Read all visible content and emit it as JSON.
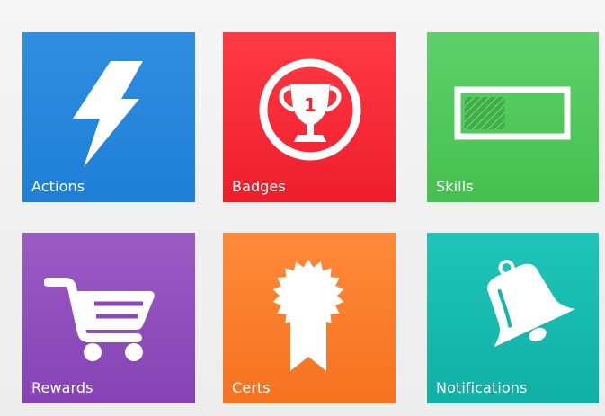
{
  "tiles": {
    "actions": {
      "label": "Actions",
      "icon": "lightning-bolt-icon",
      "color": "#2385d9"
    },
    "badges": {
      "label": "Badges",
      "icon": "trophy-icon",
      "trophy_number": "1",
      "color": "#f52936"
    },
    "skills": {
      "label": "Skills",
      "icon": "progress-bar-icon",
      "progress": 0.42,
      "color": "#52c85c"
    },
    "rewards": {
      "label": "Rewards",
      "icon": "shopping-cart-icon",
      "color": "#8f4dbc"
    },
    "certs": {
      "label": "Certs",
      "icon": "certificate-ribbon-icon",
      "color": "#fa7d2a"
    },
    "notifications": {
      "label": "Notifications",
      "icon": "bell-icon",
      "color": "#15bbae"
    }
  }
}
